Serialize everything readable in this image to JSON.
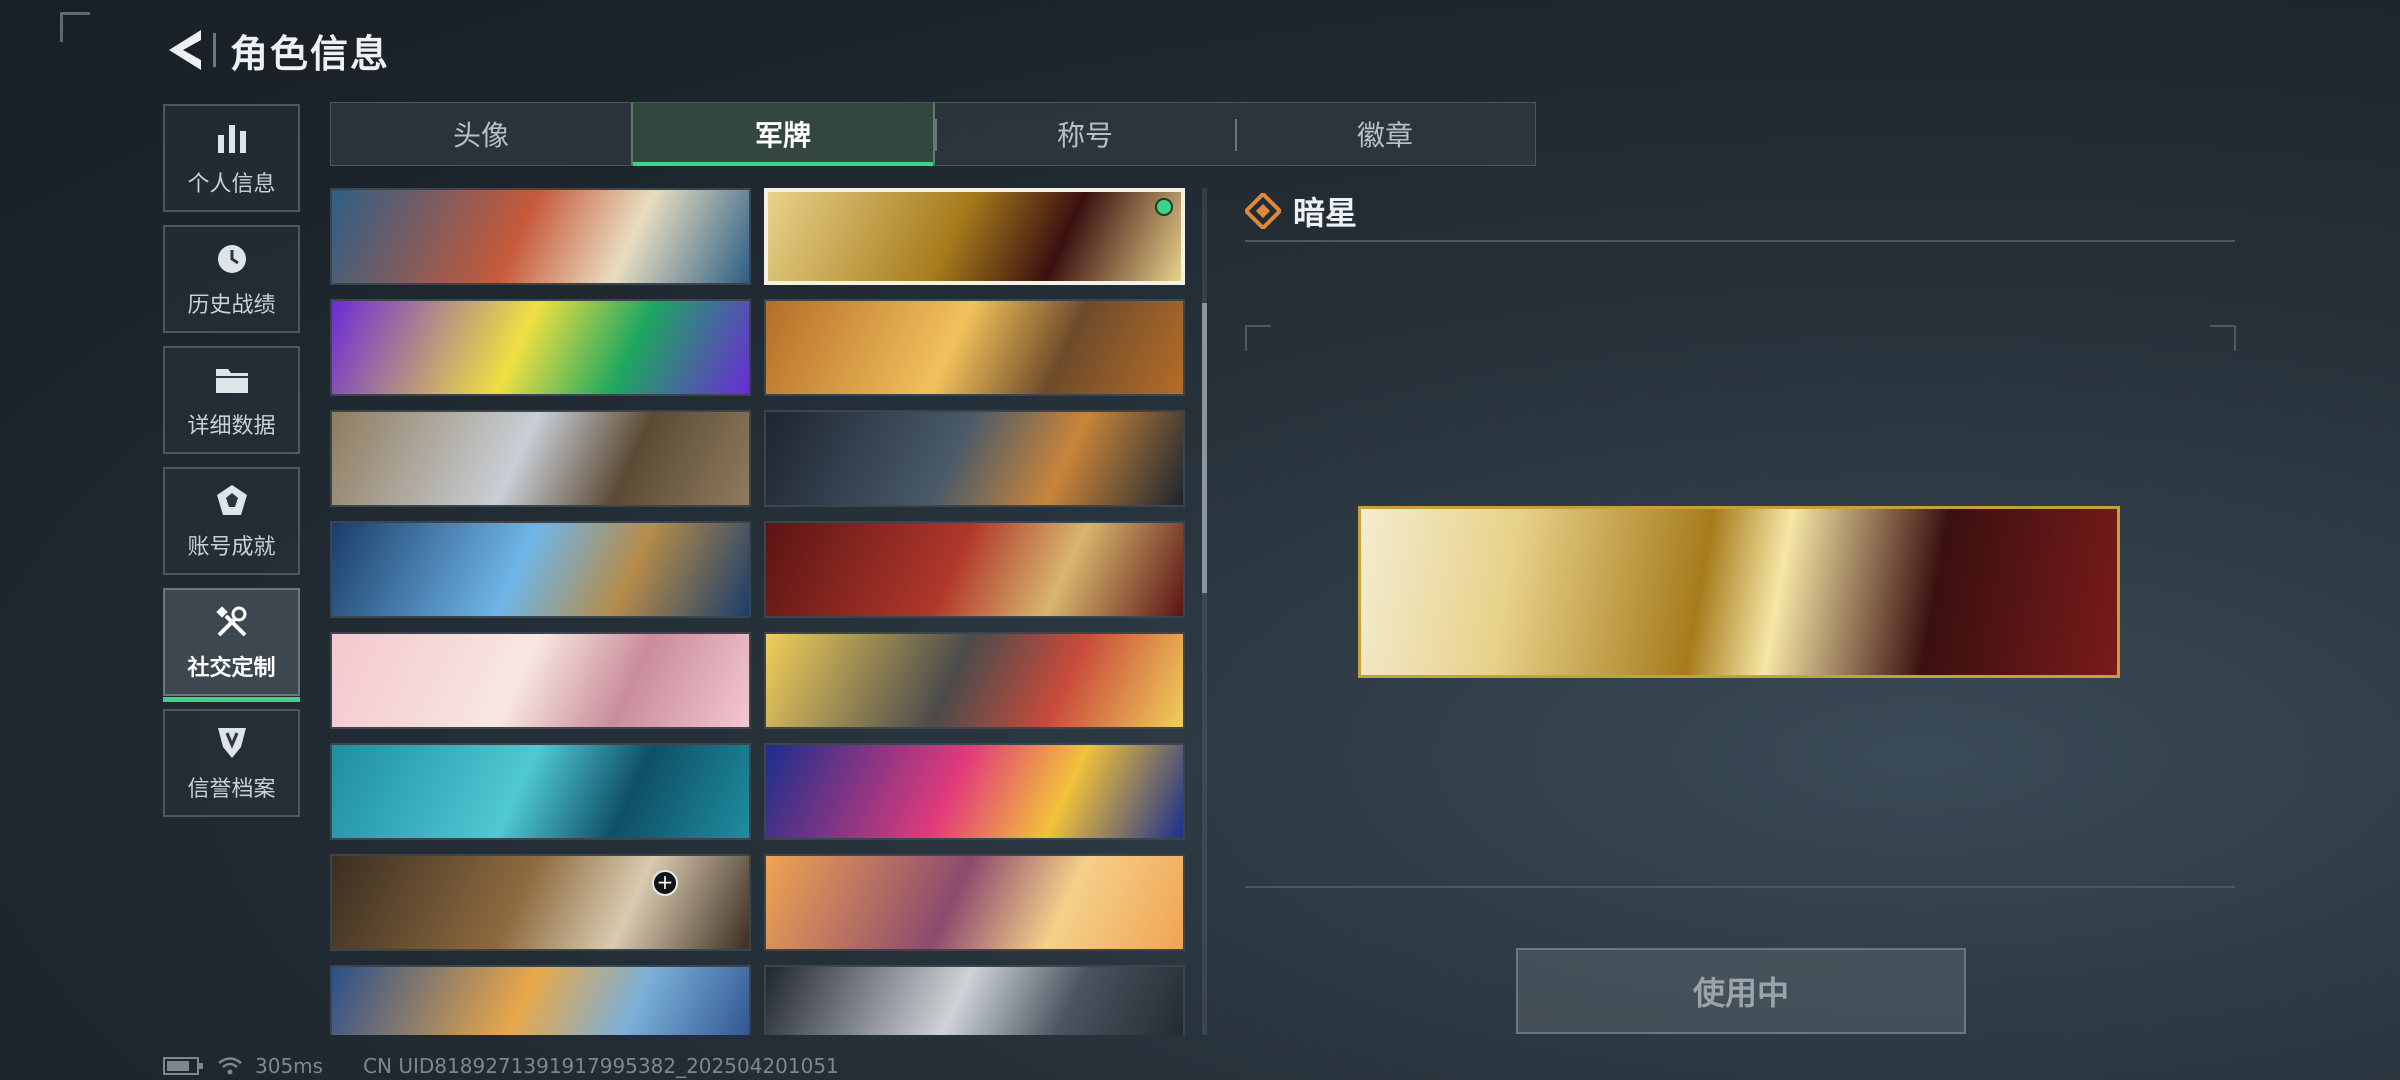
{
  "header": {
    "title": "角色信息"
  },
  "sidebar": {
    "items": [
      {
        "label": "个人信息",
        "icon": "bar-chart-icon"
      },
      {
        "label": "历史战绩",
        "icon": "clock-icon"
      },
      {
        "label": "详细数据",
        "icon": "folder-icon"
      },
      {
        "label": "账号成就",
        "icon": "achievement-icon"
      },
      {
        "label": "社交定制",
        "icon": "tools-icon",
        "active": true
      },
      {
        "label": "信誉档案",
        "icon": "shield-icon"
      }
    ]
  },
  "tabs": [
    {
      "label": "头像"
    },
    {
      "label": "军牌",
      "active": true
    },
    {
      "label": "称号"
    },
    {
      "label": "徽章"
    }
  ],
  "cards": [
    {
      "name": "octopus-waves",
      "colors": [
        "#2d5f86",
        "#c7593b",
        "#e9ddc0"
      ]
    },
    {
      "name": "dark-star",
      "colors": [
        "#e8d28a",
        "#a67b1c",
        "#3b1010"
      ],
      "selected": true
    },
    {
      "name": "zoga-neon",
      "colors": [
        "#6b2bd6",
        "#f0e042",
        "#1ea760"
      ]
    },
    {
      "name": "feast-party",
      "colors": [
        "#b56d28",
        "#f2c15c",
        "#6e4a2a"
      ]
    },
    {
      "name": "sniper-mountains",
      "colors": [
        "#8f7c5e",
        "#c9cfd6",
        "#5c4a34"
      ]
    },
    {
      "name": "tactical-team",
      "colors": [
        "#1c2530",
        "#4a5a69",
        "#c9853a"
      ]
    },
    {
      "name": "blue-flowers",
      "colors": [
        "#1a3d6a",
        "#6fb6e8",
        "#b58c4a"
      ]
    },
    {
      "name": "crimson-roses",
      "colors": [
        "#5b1414",
        "#b0372a",
        "#d8b66e"
      ]
    },
    {
      "name": "pink-tea",
      "colors": [
        "#f4c7cf",
        "#f8e7e2",
        "#c98c9b"
      ]
    },
    {
      "name": "chibi-squad",
      "colors": [
        "#f2cf5b",
        "#4b4b4b",
        "#c84b3b"
      ]
    },
    {
      "name": "ocean-boats",
      "colors": [
        "#1e8ea0",
        "#4fc9d4",
        "#0f4f66"
      ]
    },
    {
      "name": "fiesta",
      "colors": [
        "#1b2f8c",
        "#e23b7b",
        "#f2c23a"
      ]
    },
    {
      "name": "dark-interior",
      "colors": [
        "#3b2e22",
        "#8e6b3f",
        "#d9cbb0"
      ],
      "plus": true
    },
    {
      "name": "sunset-chibi",
      "colors": [
        "#f0a453",
        "#8c4a6e",
        "#f5d08a"
      ]
    },
    {
      "name": "lantern-sky",
      "colors": [
        "#2a4f8c",
        "#e8a84a",
        "#7bb0d9"
      ]
    },
    {
      "name": "masked-girl",
      "colors": [
        "#20262d",
        "#cfd3d8",
        "#4a5560"
      ]
    }
  ],
  "detail": {
    "title": "暗星",
    "icon": "diamond-icon",
    "button": "使用中"
  },
  "status": {
    "ping": "305ms",
    "uid": "CN UID8189271391917995382_202504201051"
  }
}
